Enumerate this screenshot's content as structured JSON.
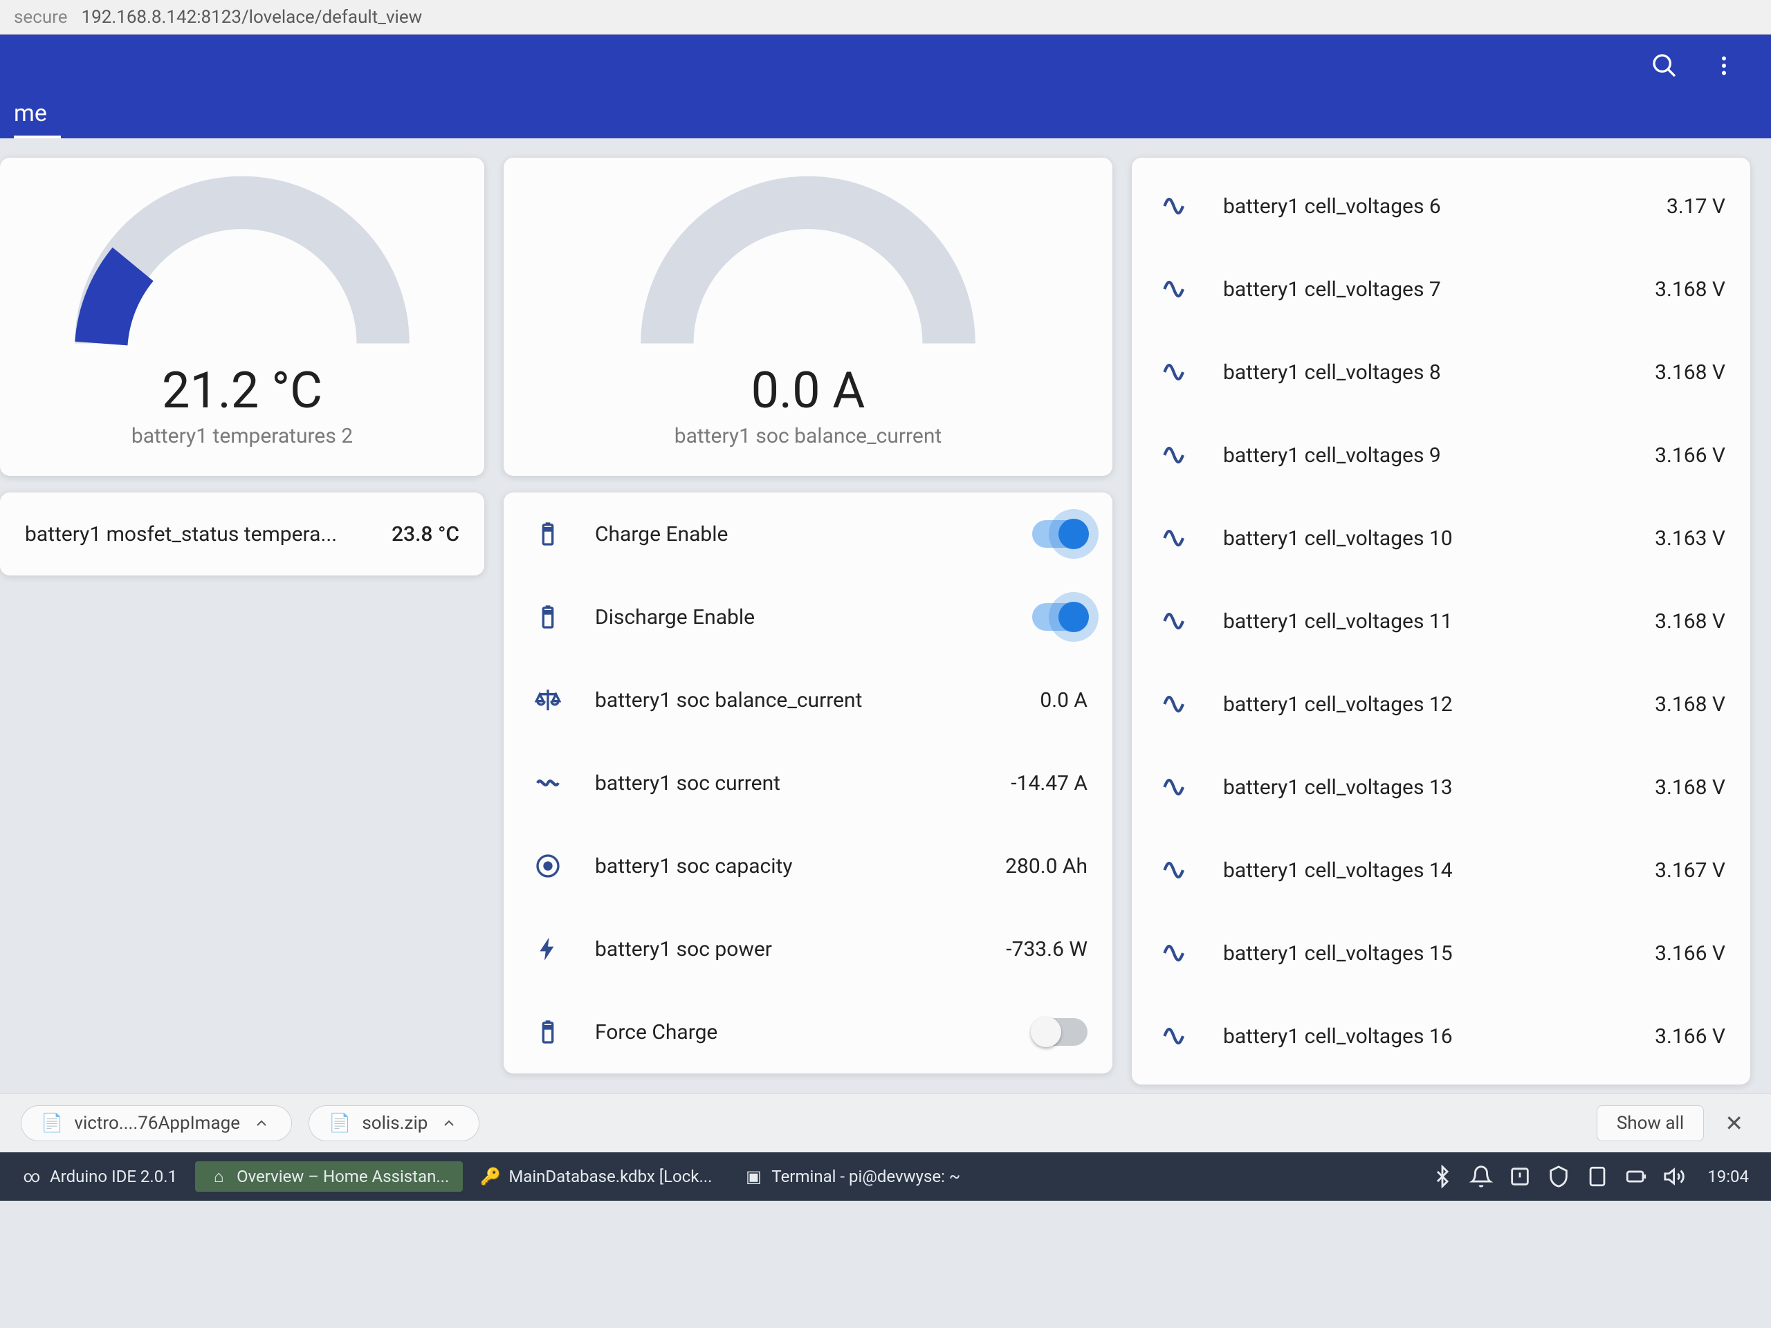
{
  "browser": {
    "secure_label": "secure",
    "url": "192.168.8.142:8123/lovelace/default_view"
  },
  "header": {
    "tab": "me"
  },
  "gauges": {
    "temp": {
      "value": "21.2 °C",
      "label": "battery1 temperatures 2",
      "fill_pct": 18
    },
    "balance": {
      "value": "0.0 A",
      "label": "battery1 soc balance_current",
      "fill_pct": 0
    }
  },
  "mosfet_row": {
    "label": "battery1 mosfet_status tempera...",
    "value": "23.8 °C"
  },
  "entities": [
    {
      "icon": "battery",
      "label": "Charge Enable",
      "toggle": true,
      "on": true
    },
    {
      "icon": "battery",
      "label": "Discharge Enable",
      "toggle": true,
      "on": true
    },
    {
      "icon": "scale",
      "label": "battery1 soc balance_current",
      "value": "0.0 A"
    },
    {
      "icon": "current",
      "label": "battery1 soc current",
      "value": "-14.47 A"
    },
    {
      "icon": "eye",
      "label": "battery1 soc capacity",
      "value": "280.0 Ah"
    },
    {
      "icon": "flash",
      "label": "battery1 soc power",
      "value": "-733.6 W"
    },
    {
      "icon": "battery",
      "label": "Force Charge",
      "toggle": true,
      "on": false
    }
  ],
  "voltages": [
    {
      "label": "battery1 cell_voltages 6",
      "value": "3.17 V"
    },
    {
      "label": "battery1 cell_voltages 7",
      "value": "3.168 V"
    },
    {
      "label": "battery1 cell_voltages 8",
      "value": "3.168 V"
    },
    {
      "label": "battery1 cell_voltages 9",
      "value": "3.166 V"
    },
    {
      "label": "battery1 cell_voltages 10",
      "value": "3.163 V"
    },
    {
      "label": "battery1 cell_voltages 11",
      "value": "3.168 V"
    },
    {
      "label": "battery1 cell_voltages 12",
      "value": "3.168 V"
    },
    {
      "label": "battery1 cell_voltages 13",
      "value": "3.168 V"
    },
    {
      "label": "battery1 cell_voltages 14",
      "value": "3.167 V"
    },
    {
      "label": "battery1 cell_voltages 15",
      "value": "3.166 V"
    },
    {
      "label": "battery1 cell_voltages 16",
      "value": "3.166 V"
    }
  ],
  "downloads": {
    "items": [
      "victro....76AppImage",
      "solis.zip"
    ],
    "show_all": "Show all"
  },
  "taskbar": {
    "items": [
      "Arduino IDE 2.0.1",
      "Overview – Home Assistan...",
      "MainDatabase.kdbx [Lock...",
      "Terminal - pi@devwyse: ~"
    ],
    "clock": "19:04"
  }
}
